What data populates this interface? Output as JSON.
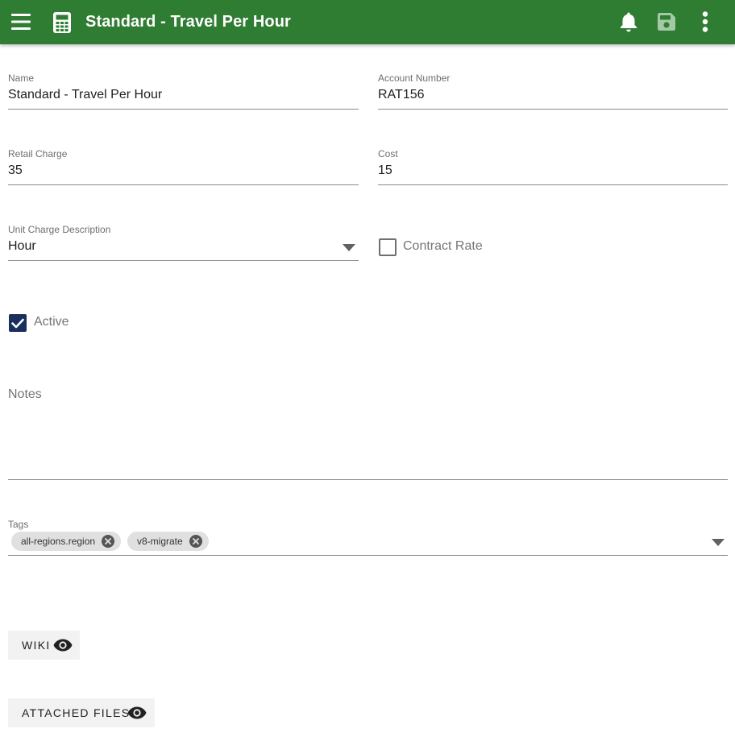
{
  "header": {
    "title": "Standard - Travel Per Hour",
    "background": "#2e7d32",
    "menu_icon": "menu-icon",
    "app_icon": "calculator-icon",
    "actions": [
      "bell-icon",
      "save-icon",
      "more-vert-icon"
    ]
  },
  "form": {
    "name": {
      "label": "Name",
      "value": "Standard - Travel Per Hour"
    },
    "account_number": {
      "label": "Account Number",
      "value": "RAT156"
    },
    "retail_charge": {
      "label": "Retail Charge",
      "value": "35"
    },
    "cost": {
      "label": "Cost",
      "value": "15"
    },
    "unit_charge_description": {
      "label": "Unit Charge Description",
      "value": "Hour"
    },
    "contract_rate": {
      "label": "Contract Rate",
      "checked": false
    },
    "active": {
      "label": "Active",
      "checked": true
    },
    "notes": {
      "placeholder": "Notes",
      "value": ""
    },
    "tags": {
      "label": "Tags",
      "chips": [
        "all-regions.region",
        "v8-migrate"
      ]
    }
  },
  "buttons": {
    "wiki": {
      "label": "WIKI",
      "icon": "eye-icon"
    },
    "attached_files": {
      "label": "ATTACHED FILES",
      "icon": "eye-icon"
    }
  },
  "colors": {
    "primary": "#2e7d32",
    "checkbox_checked": "#1a2f5e"
  }
}
